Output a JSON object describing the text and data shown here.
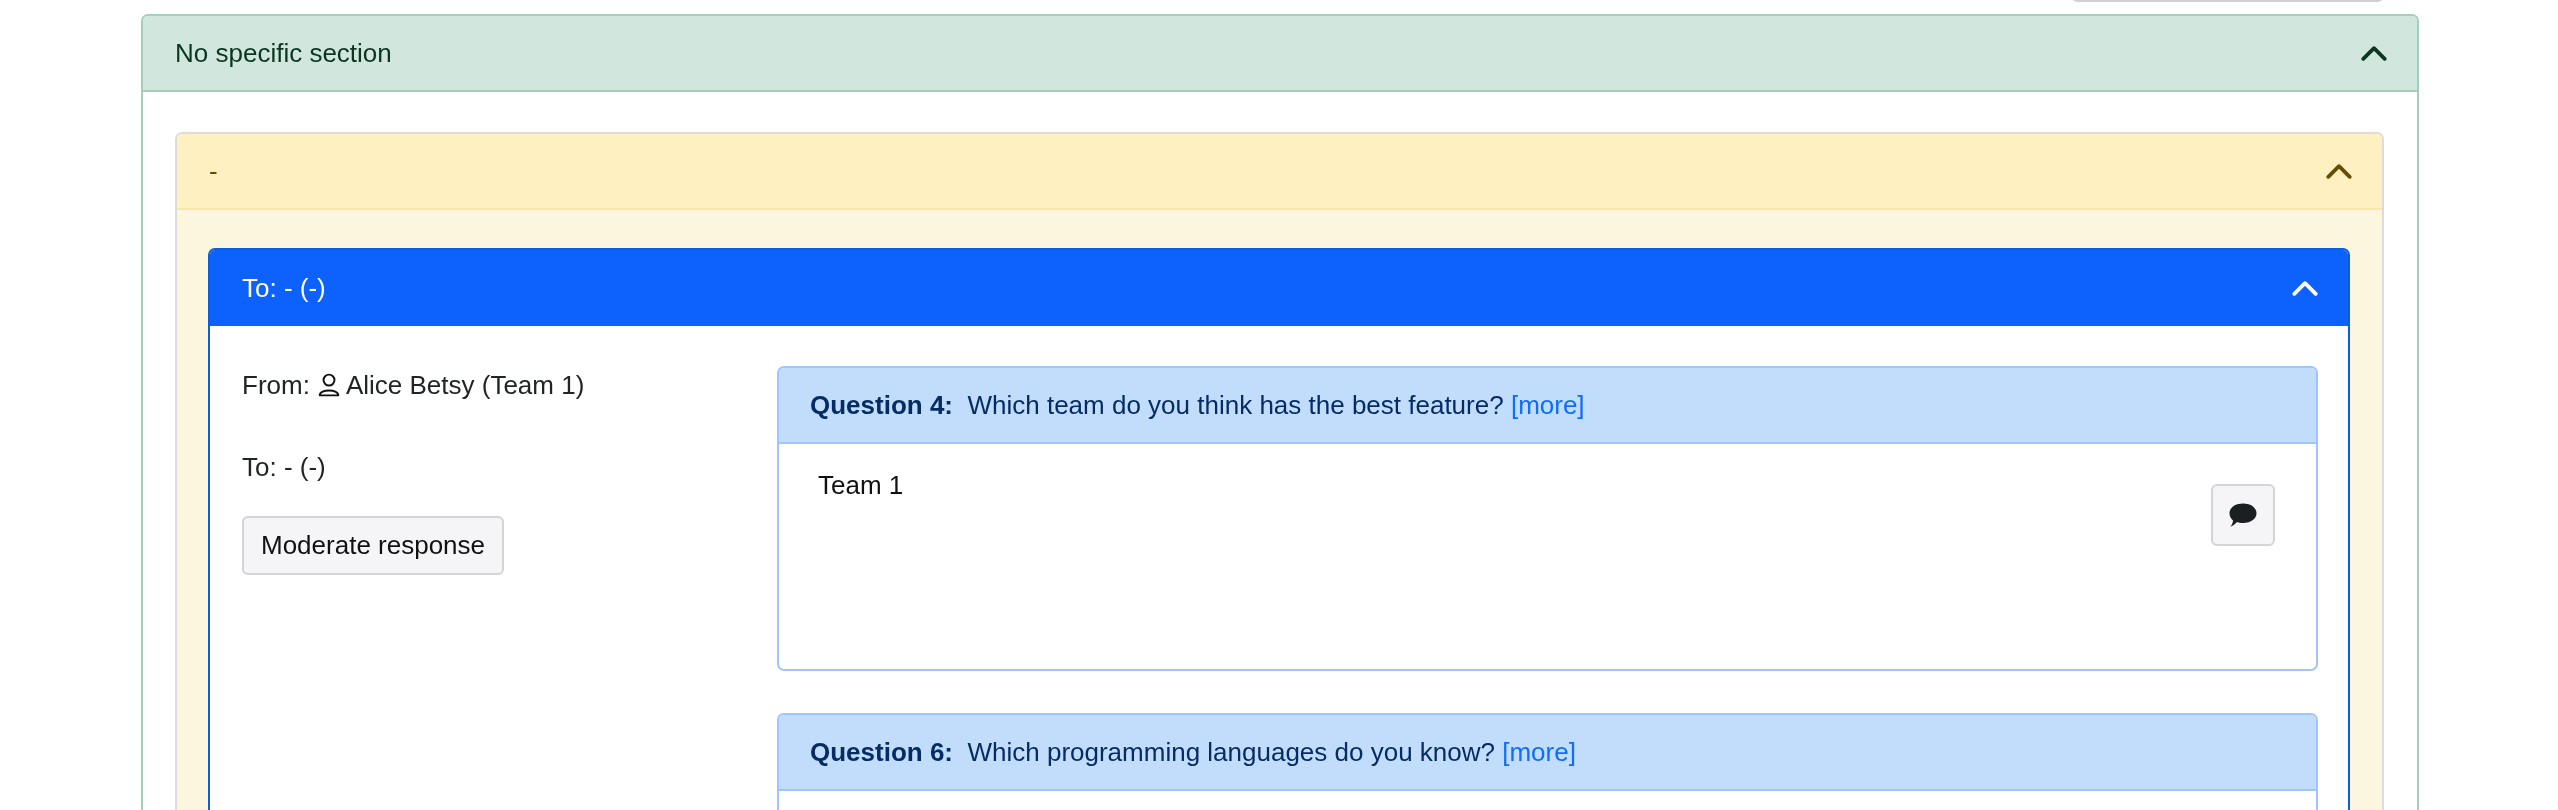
{
  "section": {
    "title": "No specific section",
    "expanded": true,
    "group": {
      "title": "-",
      "expanded": true,
      "response": {
        "title": "To: - (-)",
        "expanded": true,
        "from_label": "From:",
        "from_name": "Alice Betsy (Team 1)",
        "to_line": "To: - (-)",
        "moderate_button": "Moderate response",
        "questions": [
          {
            "header": "**Question 4:**  Which team do you think has the best feature?",
            "more_link": "[more]",
            "answer": "Team 1",
            "has_comment_button": true
          },
          {
            "header": "**Question 6:**  Which programming languages do you know?",
            "more_link": "[more]",
            "has_comment_button": false
          }
        ]
      }
    }
  }
}
